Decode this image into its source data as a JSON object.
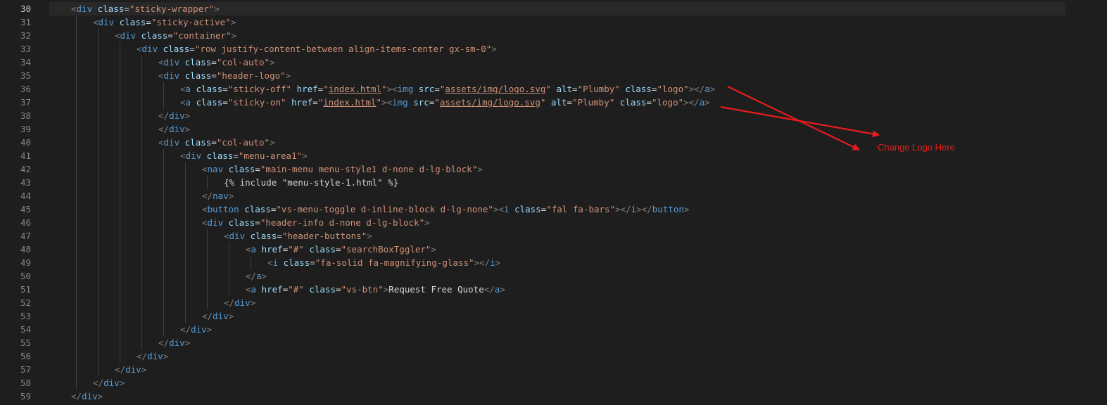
{
  "editor": {
    "line_numbers": [
      "30",
      "31",
      "32",
      "33",
      "34",
      "35",
      "36",
      "37",
      "38",
      "39",
      "40",
      "41",
      "42",
      "43",
      "44",
      "45",
      "46",
      "47",
      "48",
      "49",
      "50",
      "51",
      "52",
      "53",
      "54",
      "55",
      "56",
      "57",
      "58",
      "59"
    ],
    "lines": [
      [
        [
          "tg",
          "<"
        ],
        [
          "tn",
          "div"
        ],
        [
          "tx",
          " "
        ],
        [
          "an",
          "class"
        ],
        [
          "tx",
          "="
        ],
        [
          "av",
          "\"sticky-wrapper\""
        ],
        [
          "tg",
          ">"
        ]
      ],
      [
        [
          "tg",
          "<"
        ],
        [
          "tn",
          "div"
        ],
        [
          "tx",
          " "
        ],
        [
          "an",
          "class"
        ],
        [
          "tx",
          "="
        ],
        [
          "av",
          "\"sticky-active\""
        ],
        [
          "tg",
          ">"
        ]
      ],
      [
        [
          "tg",
          "<"
        ],
        [
          "tn",
          "div"
        ],
        [
          "tx",
          " "
        ],
        [
          "an",
          "class"
        ],
        [
          "tx",
          "="
        ],
        [
          "av",
          "\"container\""
        ],
        [
          "tg",
          ">"
        ]
      ],
      [
        [
          "tg",
          "<"
        ],
        [
          "tn",
          "div"
        ],
        [
          "tx",
          " "
        ],
        [
          "an",
          "class"
        ],
        [
          "tx",
          "="
        ],
        [
          "av",
          "\"row justify-content-between align-items-center gx-sm-0\""
        ],
        [
          "tg",
          ">"
        ]
      ],
      [
        [
          "tg",
          "<"
        ],
        [
          "tn",
          "div"
        ],
        [
          "tx",
          " "
        ],
        [
          "an",
          "class"
        ],
        [
          "tx",
          "="
        ],
        [
          "av",
          "\"col-auto\""
        ],
        [
          "tg",
          ">"
        ]
      ],
      [
        [
          "tg",
          "<"
        ],
        [
          "tn",
          "div"
        ],
        [
          "tx",
          " "
        ],
        [
          "an",
          "class"
        ],
        [
          "tx",
          "="
        ],
        [
          "av",
          "\"header-logo\""
        ],
        [
          "tg",
          ">"
        ]
      ],
      [
        [
          "tg",
          "<"
        ],
        [
          "tn",
          "a"
        ],
        [
          "tx",
          " "
        ],
        [
          "an",
          "class"
        ],
        [
          "tx",
          "="
        ],
        [
          "av",
          "\"sticky-off\""
        ],
        [
          "tx",
          " "
        ],
        [
          "an",
          "href"
        ],
        [
          "tx",
          "="
        ],
        [
          "av",
          "\""
        ],
        [
          "av u",
          "index.html"
        ],
        [
          "av",
          "\""
        ],
        [
          "tg",
          "><"
        ],
        [
          "tn",
          "img"
        ],
        [
          "tx",
          " "
        ],
        [
          "an",
          "src"
        ],
        [
          "tx",
          "="
        ],
        [
          "av",
          "\""
        ],
        [
          "av u",
          "assets/img/logo.svg"
        ],
        [
          "av",
          "\""
        ],
        [
          "tx",
          " "
        ],
        [
          "an",
          "alt"
        ],
        [
          "tx",
          "="
        ],
        [
          "av",
          "\"Plumby\""
        ],
        [
          "tx",
          " "
        ],
        [
          "an",
          "class"
        ],
        [
          "tx",
          "="
        ],
        [
          "av",
          "\"logo\""
        ],
        [
          "tg",
          "></"
        ],
        [
          "tn",
          "a"
        ],
        [
          "tg",
          ">"
        ]
      ],
      [
        [
          "tg",
          "<"
        ],
        [
          "tn",
          "a"
        ],
        [
          "tx",
          " "
        ],
        [
          "an",
          "class"
        ],
        [
          "tx",
          "="
        ],
        [
          "av",
          "\"sticky-on\""
        ],
        [
          "tx",
          " "
        ],
        [
          "an",
          "href"
        ],
        [
          "tx",
          "="
        ],
        [
          "av",
          "\""
        ],
        [
          "av u",
          "index.html"
        ],
        [
          "av",
          "\""
        ],
        [
          "tg",
          "><"
        ],
        [
          "tn",
          "img"
        ],
        [
          "tx",
          " "
        ],
        [
          "an",
          "src"
        ],
        [
          "tx",
          "="
        ],
        [
          "av",
          "\""
        ],
        [
          "av u",
          "assets/img/logo.svg"
        ],
        [
          "av",
          "\""
        ],
        [
          "tx",
          " "
        ],
        [
          "an",
          "alt"
        ],
        [
          "tx",
          "="
        ],
        [
          "av",
          "\"Plumby\""
        ],
        [
          "tx",
          " "
        ],
        [
          "an",
          "class"
        ],
        [
          "tx",
          "="
        ],
        [
          "av",
          "\"logo\""
        ],
        [
          "tg",
          "></"
        ],
        [
          "tn",
          "a"
        ],
        [
          "tg",
          ">"
        ]
      ],
      [
        [
          "tg",
          "</"
        ],
        [
          "tn",
          "div"
        ],
        [
          "tg",
          ">"
        ]
      ],
      [
        [
          "tg",
          "</"
        ],
        [
          "tn",
          "div"
        ],
        [
          "tg",
          ">"
        ]
      ],
      [
        [
          "tg",
          "<"
        ],
        [
          "tn",
          "div"
        ],
        [
          "tx",
          " "
        ],
        [
          "an",
          "class"
        ],
        [
          "tx",
          "="
        ],
        [
          "av",
          "\"col-auto\""
        ],
        [
          "tg",
          ">"
        ]
      ],
      [
        [
          "tg",
          "<"
        ],
        [
          "tn",
          "div"
        ],
        [
          "tx",
          " "
        ],
        [
          "an",
          "class"
        ],
        [
          "tx",
          "="
        ],
        [
          "av",
          "\"menu-area1\""
        ],
        [
          "tg",
          ">"
        ]
      ],
      [
        [
          "tg",
          "<"
        ],
        [
          "tn",
          "nav"
        ],
        [
          "tx",
          " "
        ],
        [
          "an",
          "class"
        ],
        [
          "tx",
          "="
        ],
        [
          "av",
          "\"main-menu menu-style1 d-none d-lg-block\""
        ],
        [
          "tg",
          ">"
        ]
      ],
      [
        [
          "tx",
          "{% include \"menu-style-1.html\" %}"
        ]
      ],
      [
        [
          "tg",
          "</"
        ],
        [
          "tn",
          "nav"
        ],
        [
          "tg",
          ">"
        ]
      ],
      [
        [
          "tg",
          "<"
        ],
        [
          "tn",
          "button"
        ],
        [
          "tx",
          " "
        ],
        [
          "an",
          "class"
        ],
        [
          "tx",
          "="
        ],
        [
          "av",
          "\"vs-menu-toggle d-inline-block d-lg-none\""
        ],
        [
          "tg",
          "><"
        ],
        [
          "tn",
          "i"
        ],
        [
          "tx",
          " "
        ],
        [
          "an",
          "class"
        ],
        [
          "tx",
          "="
        ],
        [
          "av",
          "\"fal fa-bars\""
        ],
        [
          "tg",
          "></"
        ],
        [
          "tn",
          "i"
        ],
        [
          "tg",
          "></"
        ],
        [
          "tn",
          "button"
        ],
        [
          "tg",
          ">"
        ]
      ],
      [
        [
          "tg",
          "<"
        ],
        [
          "tn",
          "div"
        ],
        [
          "tx",
          " "
        ],
        [
          "an",
          "class"
        ],
        [
          "tx",
          "="
        ],
        [
          "av",
          "\"header-info d-none d-lg-block\""
        ],
        [
          "tg",
          ">"
        ]
      ],
      [
        [
          "tg",
          "<"
        ],
        [
          "tn",
          "div"
        ],
        [
          "tx",
          " "
        ],
        [
          "an",
          "class"
        ],
        [
          "tx",
          "="
        ],
        [
          "av",
          "\"header-buttons\""
        ],
        [
          "tg",
          ">"
        ]
      ],
      [
        [
          "tg",
          "<"
        ],
        [
          "tn",
          "a"
        ],
        [
          "tx",
          " "
        ],
        [
          "an",
          "href"
        ],
        [
          "tx",
          "="
        ],
        [
          "av",
          "\"#\""
        ],
        [
          "tx",
          " "
        ],
        [
          "an",
          "class"
        ],
        [
          "tx",
          "="
        ],
        [
          "av",
          "\"searchBoxTggler\""
        ],
        [
          "tg",
          ">"
        ]
      ],
      [
        [
          "tg",
          "<"
        ],
        [
          "tn",
          "i"
        ],
        [
          "tx",
          " "
        ],
        [
          "an",
          "class"
        ],
        [
          "tx",
          "="
        ],
        [
          "av",
          "\"fa-solid fa-magnifying-glass\""
        ],
        [
          "tg",
          "></"
        ],
        [
          "tn",
          "i"
        ],
        [
          "tg",
          ">"
        ]
      ],
      [
        [
          "tg",
          "</"
        ],
        [
          "tn",
          "a"
        ],
        [
          "tg",
          ">"
        ]
      ],
      [
        [
          "tg",
          "<"
        ],
        [
          "tn",
          "a"
        ],
        [
          "tx",
          " "
        ],
        [
          "an",
          "href"
        ],
        [
          "tx",
          "="
        ],
        [
          "av",
          "\"#\""
        ],
        [
          "tx",
          " "
        ],
        [
          "an",
          "class"
        ],
        [
          "tx",
          "="
        ],
        [
          "av",
          "\"vs-btn\""
        ],
        [
          "tg",
          ">"
        ],
        [
          "tx",
          "Request Free Quote"
        ],
        [
          "tg",
          "</"
        ],
        [
          "tn",
          "a"
        ],
        [
          "tg",
          ">"
        ]
      ],
      [
        [
          "tg",
          "</"
        ],
        [
          "tn",
          "div"
        ],
        [
          "tg",
          ">"
        ]
      ],
      [
        [
          "tg",
          "</"
        ],
        [
          "tn",
          "div"
        ],
        [
          "tg",
          ">"
        ]
      ],
      [
        [
          "tg",
          "</"
        ],
        [
          "tn",
          "div"
        ],
        [
          "tg",
          ">"
        ]
      ],
      [
        [
          "tg",
          "</"
        ],
        [
          "tn",
          "div"
        ],
        [
          "tg",
          ">"
        ]
      ],
      [
        [
          "tg",
          "</"
        ],
        [
          "tn",
          "div"
        ],
        [
          "tg",
          ">"
        ]
      ],
      [
        [
          "tg",
          "</"
        ],
        [
          "tn",
          "div"
        ],
        [
          "tg",
          ">"
        ]
      ],
      [
        [
          "tg",
          "</"
        ],
        [
          "tn",
          "div"
        ],
        [
          "tg",
          ">"
        ]
      ],
      [
        [
          "tg",
          "</"
        ],
        [
          "tn",
          "div"
        ],
        [
          "tg",
          ">"
        ]
      ]
    ]
  },
  "annotation": {
    "label": "Change Logo Here",
    "color": "#e81c1c"
  },
  "theme": {
    "background": "#1e1e1e",
    "tag_name": "#569cd6",
    "attr_name": "#9cdcfe",
    "attr_value": "#ce9178",
    "bracket": "#808080",
    "text": "#d4d4d4",
    "line_number": "#858585"
  }
}
